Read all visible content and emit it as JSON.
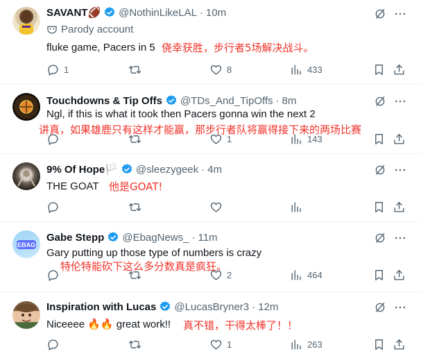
{
  "colors": {
    "accent": "#1d9bf0",
    "muted": "#536471",
    "annotation": "#f0332a"
  },
  "tweets": [
    {
      "display_name": "SAVANT🏈",
      "handle": "@NothinLikeLAL",
      "time": "10m",
      "label": "Parody account",
      "text": "fluke game, Pacers in 5",
      "translation": "侥幸获胜，步行者5场解决战斗。",
      "replies": "1",
      "reposts": "",
      "likes": "8",
      "views": "433"
    },
    {
      "display_name": "Touchdowns & Tip Offs",
      "handle": "@TDs_And_TipOffs",
      "time": "8m",
      "text": "Ngl, if this is what it took then Pacers gonna win the next 2",
      "translation": "讲真，如果雄鹿只有这样才能赢，那步行者队将赢得接下来的两场比赛",
      "replies": "",
      "reposts": "",
      "likes": "1",
      "views": "143"
    },
    {
      "display_name": "9% Of Hope🏳️",
      "handle": "@sleezygeek",
      "time": "4m",
      "text": "THE GOAT",
      "translation": "他是GOAT!",
      "replies": "",
      "reposts": "",
      "likes": "",
      "views": ""
    },
    {
      "display_name": "Gabe Stepp",
      "handle": "@EbagNews_",
      "time": "11m",
      "avatar_text": "EBAG",
      "text": "Gary putting up those type of numbers is crazy",
      "translation": "特伦特能砍下这么多分数真是疯狂。",
      "replies": "",
      "reposts": "",
      "likes": "2",
      "views": "464"
    },
    {
      "display_name": "Inspiration with Lucas",
      "handle": "@LucasBryner3",
      "time": "12m",
      "text": "Niceeee 🔥🔥 great work!!",
      "translation": "真不错，干得太棒了！！",
      "replies": "",
      "reposts": "",
      "likes": "1",
      "views": "263"
    }
  ]
}
